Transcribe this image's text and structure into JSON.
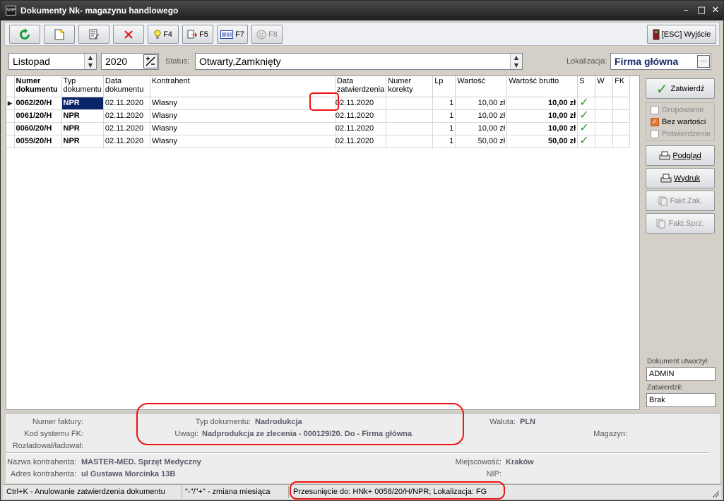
{
  "window": {
    "title": "Dokumenty Nk- magazynu handlowego",
    "app_icon": "SMP"
  },
  "toolbar": {
    "buttons": [
      {
        "name": "refresh",
        "icon": "refresh-icon",
        "label": ""
      },
      {
        "name": "new",
        "icon": "new-document-icon",
        "label": ""
      },
      {
        "name": "edit",
        "icon": "edit-document-icon",
        "label": ""
      },
      {
        "name": "delete",
        "icon": "delete-icon",
        "label": ""
      },
      {
        "name": "f4",
        "icon": "lightbulb-icon",
        "label": "F4"
      },
      {
        "name": "f5",
        "icon": "export-icon",
        "label": "F5"
      },
      {
        "name": "f7",
        "icon": "barcode-icon",
        "label": "F7"
      },
      {
        "name": "f8",
        "icon": "smiley-icon",
        "label": "F8"
      }
    ],
    "exit_label": "[ESC] Wyjście"
  },
  "filters": {
    "month": "Listopad",
    "year": "2020",
    "status_label": "Status:",
    "status_value": "Otwarty,Zamknięty",
    "location_label": "Lokalizacja:",
    "location_value": "Firma główna",
    "browse_label": "..."
  },
  "grid": {
    "columns": [
      {
        "label": "Numer dokumentu",
        "bold": true
      },
      {
        "label": "Typ dokumentu"
      },
      {
        "label": "Data dokumentu"
      },
      {
        "label": "Kontrahent"
      },
      {
        "label": "Data zatwierdzenia"
      },
      {
        "label": "Numer korekty"
      },
      {
        "label": "Lp"
      },
      {
        "label": "Wartość"
      },
      {
        "label": "Wartość brutto"
      },
      {
        "label": "S"
      },
      {
        "label": "W"
      },
      {
        "label": "FK"
      }
    ],
    "rows": [
      {
        "numer": "0062/20/H",
        "typ": "NPR",
        "data": "02.11.2020",
        "kontrahent": "Własny",
        "data_zatw": "02.11.2020",
        "korekta": "",
        "lp": "1",
        "wartosc": "10,00 zł",
        "brutto": "10,00 zł",
        "s": "✓",
        "w": "",
        "fk": ""
      },
      {
        "numer": "0061/20/H",
        "typ": "NPR",
        "data": "02.11.2020",
        "kontrahent": "Własny",
        "data_zatw": "02.11.2020",
        "korekta": "",
        "lp": "1",
        "wartosc": "10,00 zł",
        "brutto": "10,00 zł",
        "s": "✓",
        "w": "",
        "fk": ""
      },
      {
        "numer": "0060/20/H",
        "typ": "NPR",
        "data": "02.11.2020",
        "kontrahent": "Własny",
        "data_zatw": "02.11.2020",
        "korekta": "",
        "lp": "1",
        "wartosc": "10,00 zł",
        "brutto": "10,00 zł",
        "s": "✓",
        "w": "",
        "fk": ""
      },
      {
        "numer": "0059/20/H",
        "typ": "NPR",
        "data": "02.11.2020",
        "kontrahent": "Własny",
        "data_zatw": "02.11.2020",
        "korekta": "",
        "lp": "1",
        "wartosc": "50,00 zł",
        "brutto": "50,00 zł",
        "s": "✓",
        "w": "",
        "fk": ""
      }
    ]
  },
  "side": {
    "approve_label": "Zatwierdź",
    "options": [
      {
        "label": "Grupowanie",
        "checked": false,
        "enabled": false
      },
      {
        "label": "Bez wartości",
        "checked": true,
        "enabled": true
      },
      {
        "label": "Potwierdzenie",
        "checked": false,
        "enabled": false
      }
    ],
    "preview_label": "Podgląd",
    "print_label": "Wydruk",
    "fakt_zak_label": "Fakt.Zak.",
    "fakt_sprz_label": "Fakt.Sprz.",
    "created_by_label": "Dokument utworzył:",
    "created_by_value": "ADMIN",
    "approved_by_label": "Zatwierdził:",
    "approved_by_value": "Brak"
  },
  "details": {
    "invoice_number_label": "Numer faktury:",
    "fk_code_label": "Kod systemu FK:",
    "unloader_label": "Rozładował/ładował:",
    "doc_type_label": "Typ dokumentu:",
    "doc_type_value": "Nadrodukcja",
    "notes_label": "Uwagi:",
    "notes_value": "Nadprodukcja ze zlecenia - 000129/20. Do - Firma główna",
    "currency_label": "Waluta:",
    "currency_value": "PLN",
    "warehouse_label": "Magazyn:",
    "contractor_name_label": "Nazwa kontrahenta:",
    "contractor_name_value": "MASTER-MED. Sprzęt Medyczny",
    "contractor_address_label": "Adres kontrahenta:",
    "contractor_address_value": "ul Gustawa Morcinka 13B",
    "city_label": "Miejscowość:",
    "city_value": "Kraków",
    "nip_label": "NIP:"
  },
  "statusbar": {
    "hint1": "Ctrl+K - Anulowanie zatwierdzenia dokumentu",
    "hint2": "\"-\"/\"+\" - zmiana miesiąca",
    "shift": "Przesunięcie do: HNk+ 0058/20/H/NPR; Lokalizacja: FG"
  },
  "colors": {
    "selection": "#0a246a",
    "annotation": "#e11111",
    "check": "#2a9a2a"
  }
}
